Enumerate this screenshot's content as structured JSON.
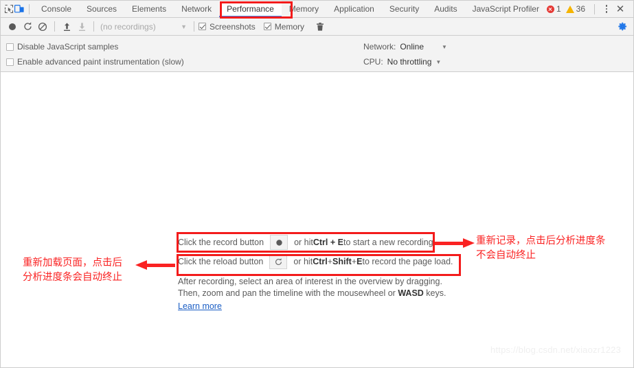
{
  "window": {
    "accent_blue": "#4285f4",
    "annotation_red": "#fa2222"
  },
  "tabbar": {
    "inspect_icon": "inspect-element-icon",
    "device_icon": "device-toolbar-icon",
    "tabs": [
      {
        "label": "Console",
        "active": false
      },
      {
        "label": "Sources",
        "active": false
      },
      {
        "label": "Elements",
        "active": false
      },
      {
        "label": "Network",
        "active": false
      },
      {
        "label": "Performance",
        "active": true
      },
      {
        "label": "Memory",
        "active": false
      },
      {
        "label": "Application",
        "active": false
      },
      {
        "label": "Security",
        "active": false
      },
      {
        "label": "Audits",
        "active": false
      },
      {
        "label": "JavaScript Profiler",
        "active": false
      }
    ],
    "error_count": "1",
    "warning_count": "36",
    "more_icon": "kebab-menu-icon",
    "close_icon": "close-icon",
    "close_glyph": "✕"
  },
  "toolbar": {
    "record_icon": "record-icon",
    "reload_icon": "reload-icon",
    "clear_icon": "clear-icon",
    "load_icon": "upload-profile-icon",
    "save_icon": "download-profile-icon",
    "recordings_value": "(no recordings)",
    "recordings_caret": "▼",
    "screenshots_label": "Screenshots",
    "screenshots_checked": true,
    "memory_label": "Memory",
    "memory_checked": true,
    "trash_icon": "trash-icon",
    "settings_icon": "gear-icon"
  },
  "settings": {
    "disable_js_samples_label": "Disable JavaScript samples",
    "disable_js_samples_checked": false,
    "advanced_paint_label": "Enable advanced paint instrumentation (slow)",
    "advanced_paint_checked": false,
    "network_label": "Network:",
    "network_value": "Online",
    "cpu_label": "CPU:",
    "cpu_value": "No throttling",
    "caret": "▼"
  },
  "landing": {
    "record_hint_prefix": "Click the record button",
    "record_hint_suffix_a": "or hit ",
    "record_hint_keys": "Ctrl + E",
    "record_hint_suffix_b": " to start a new recording.",
    "reload_hint_prefix": "Click the reload button",
    "reload_hint_suffix_a": "or hit ",
    "reload_hint_keys_a": "Ctrl",
    "reload_hint_plus1": " + ",
    "reload_hint_keys_b": "Shift",
    "reload_hint_plus2": " + ",
    "reload_hint_keys_c": "E",
    "reload_hint_suffix_b": " to record the page load.",
    "paragraph_line1": "After recording, select an area of interest in the overview by dragging.",
    "paragraph_line2_a": "Then, zoom and pan the timeline with the mousewheel or ",
    "paragraph_line2_keys": "WASD",
    "paragraph_line2_b": " keys.",
    "learn_more": "Learn more",
    "record_button_icon": "record-icon",
    "reload_button_icon": "reload-icon"
  },
  "annotations": {
    "right_line1": "重新记录，点击后分析进度条",
    "right_line2": "不会自动终止",
    "left_line1": "重新加载页面，点击后",
    "left_line2": "分析进度条会自动终止"
  },
  "watermark": {
    "text": "https://blog.csdn.net/xiaozr1223"
  }
}
